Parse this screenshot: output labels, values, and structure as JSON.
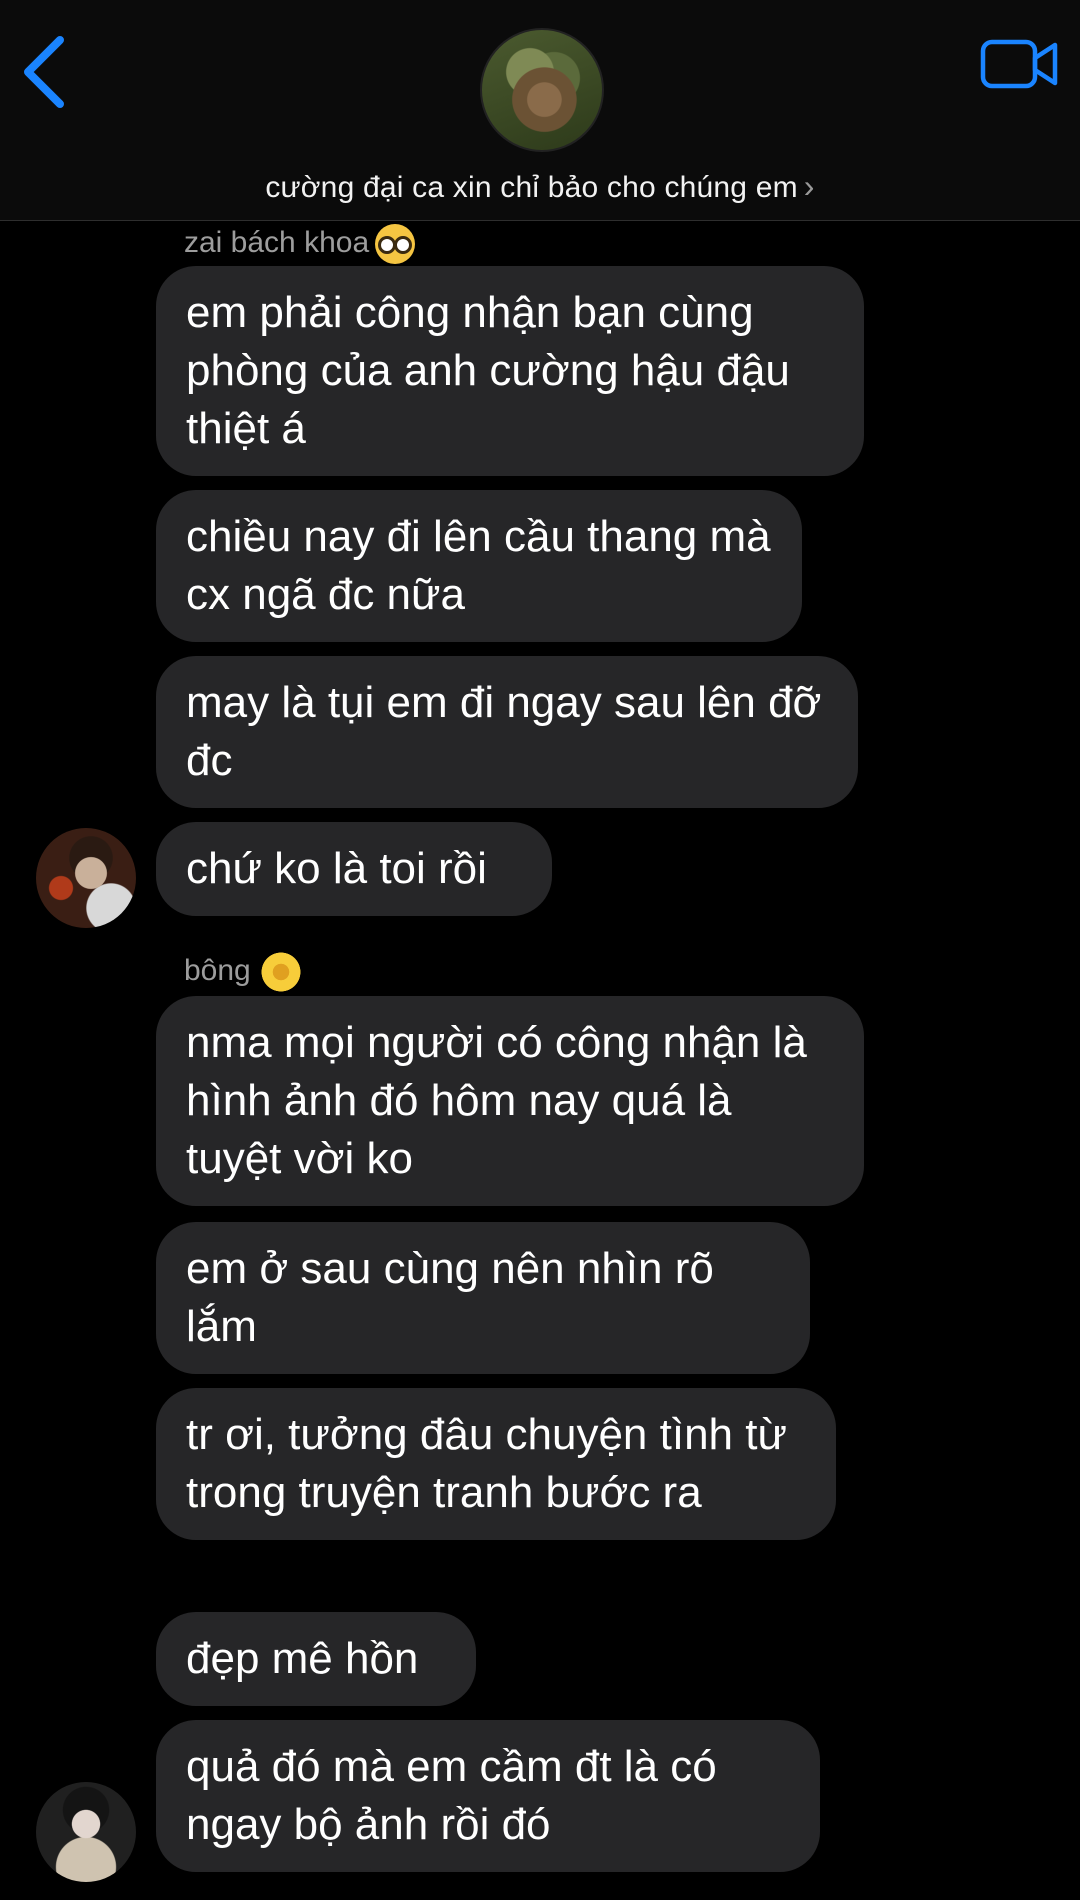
{
  "header": {
    "group_name": "cường đại ca xin chỉ bảo cho chúng em",
    "chevron": "›",
    "back_icon": "chevron-left-icon",
    "video_icon": "video-camera-icon",
    "accent_color": "#1a84ff"
  },
  "messages": [
    {
      "sender": "zai bách khoa",
      "sender_emoji": "nerd-face-emoji",
      "bubbles": [
        "em phải công nhận bạn cùng phòng của anh cường hậu đậu thiệt á",
        "chiều nay đi lên cầu thang mà cx ngã đc nữa",
        "may là tụi em đi ngay sau lên đỡ đc",
        "chứ ko là toi rồi"
      ]
    },
    {
      "sender": "bông",
      "sender_emoji": "sunflower-emoji",
      "bubbles": [
        "nma mọi người có công nhận là hình ảnh đó hôm nay quá là tuyệt vời ko",
        "em ở sau cùng nên nhìn rõ lắm",
        "tr ơi, tưởng đâu chuyện tình từ trong truyện tranh bước ra",
        "đẹp mê hồn",
        "quả đó mà em cầm đt là có ngay bộ ảnh rồi đó"
      ]
    }
  ],
  "colors": {
    "background": "#000000",
    "bubble": "#262628",
    "sender_name": "#9d9d9d"
  }
}
